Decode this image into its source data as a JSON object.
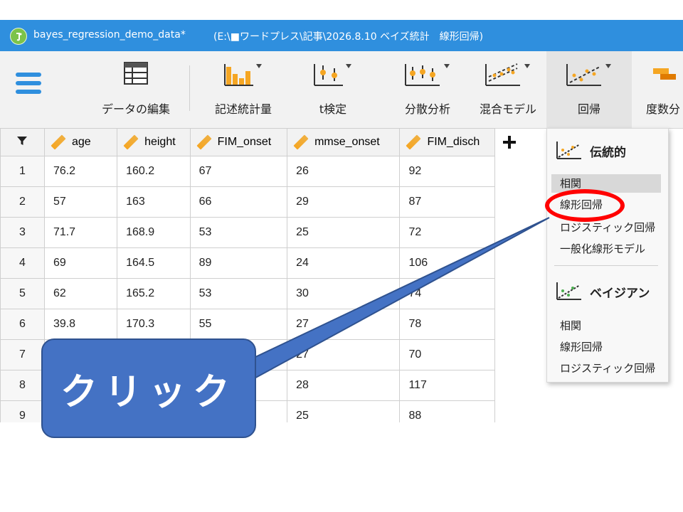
{
  "window": {
    "file_name": "bayes_regression_demo_data*",
    "path": "(E:\\■ワードプレス\\記事\\2026.8.10 ベイズ統計　線形回帰)"
  },
  "ribbon": {
    "items": [
      {
        "label": "データの編集",
        "icon": "table-grid-icon"
      },
      {
        "label": "記述統計量",
        "icon": "bar-chart-icon"
      },
      {
        "label": "t検定",
        "icon": "t-test-icon"
      },
      {
        "label": "分散分析",
        "icon": "anova-icon"
      },
      {
        "label": "混合モデル",
        "icon": "mixed-model-icon"
      },
      {
        "label": "回帰",
        "icon": "regression-icon"
      },
      {
        "label": "度数分",
        "icon": "frequency-icon"
      }
    ]
  },
  "table": {
    "columns": [
      "age",
      "height",
      "FIM_onset",
      "mmse_onset",
      "FIM_disch"
    ],
    "rows": [
      {
        "n": "1",
        "cells": [
          "76.2",
          "160.2",
          "67",
          "26",
          "92"
        ]
      },
      {
        "n": "2",
        "cells": [
          "57",
          "163",
          "66",
          "29",
          "87"
        ]
      },
      {
        "n": "3",
        "cells": [
          "71.7",
          "168.9",
          "53",
          "25",
          "72"
        ]
      },
      {
        "n": "4",
        "cells": [
          "69",
          "164.5",
          "89",
          "24",
          "106"
        ]
      },
      {
        "n": "5",
        "cells": [
          "62",
          "165.2",
          "53",
          "30",
          "74"
        ]
      },
      {
        "n": "6",
        "cells": [
          "39.8",
          "170.3",
          "55",
          "27",
          "78"
        ]
      },
      {
        "n": "7",
        "cells": [
          "",
          "",
          "",
          "27",
          "70"
        ]
      },
      {
        "n": "8",
        "cells": [
          "",
          "",
          "",
          "28",
          "117"
        ]
      },
      {
        "n": "9",
        "cells": [
          "",
          "",
          "",
          "25",
          "88"
        ]
      }
    ]
  },
  "dropdown": {
    "classical_header": "伝統的",
    "classical_items": [
      "相関",
      "線形回帰",
      "ロジスティック回帰",
      "一般化線形モデル"
    ],
    "bayesian_header": "ベイジアン",
    "bayesian_items": [
      "相関",
      "線形回帰",
      "ロジスティック回帰"
    ]
  },
  "annotation": {
    "callout_text": "クリック"
  },
  "colors": {
    "titlebar": "#2f8fde",
    "accent_orange": "#f5a623",
    "callout": "#4472c4",
    "highlight_circle": "#ff0000"
  }
}
